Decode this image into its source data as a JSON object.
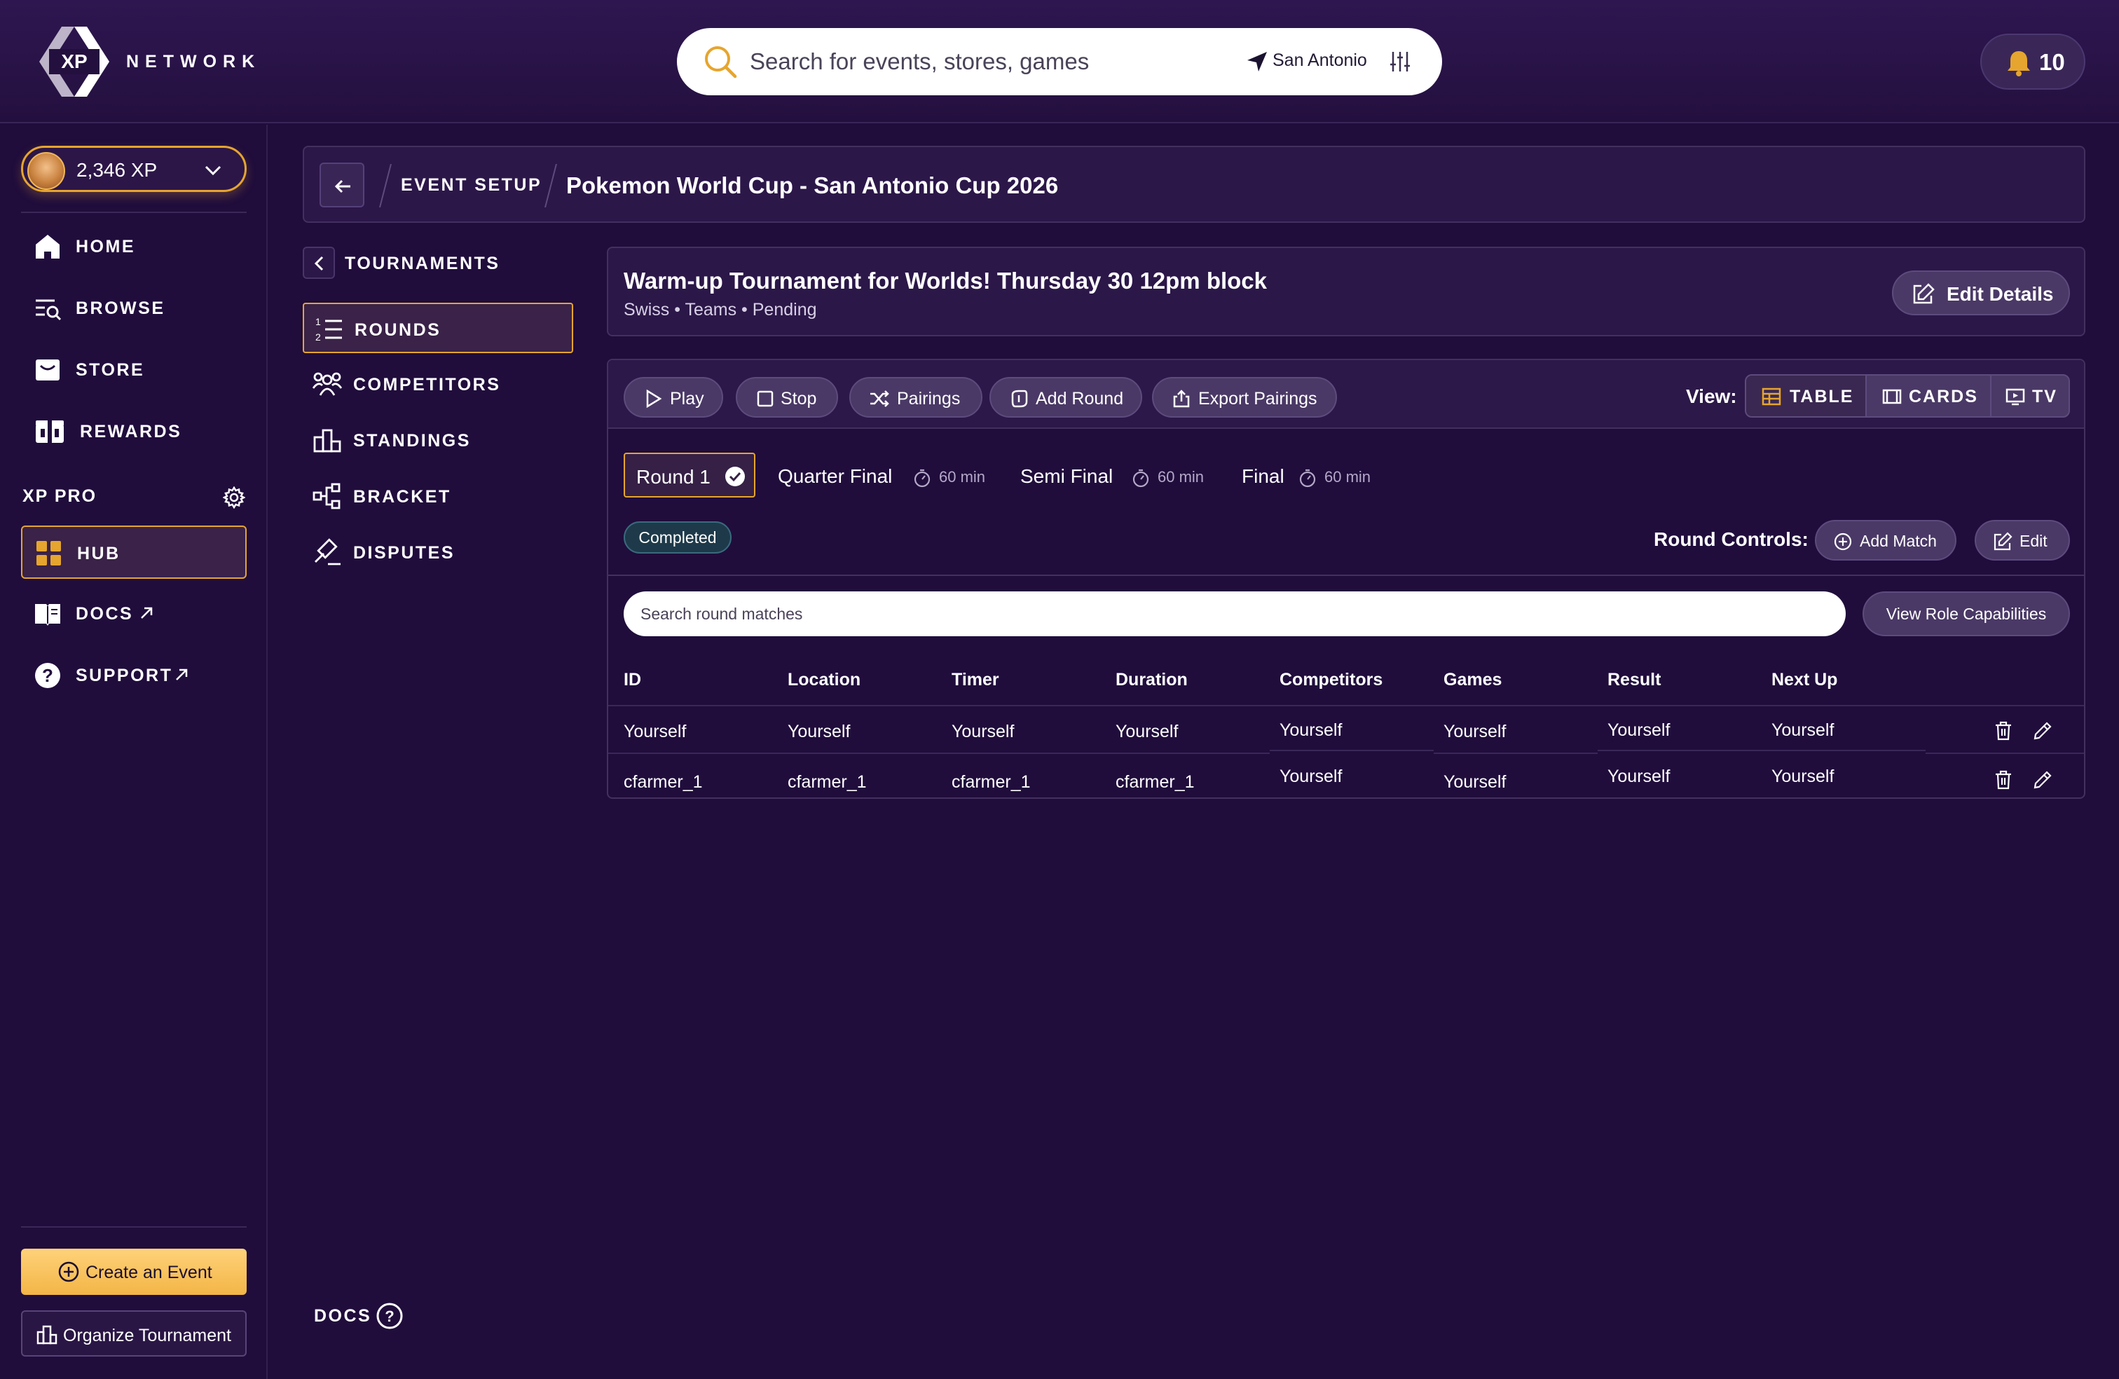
{
  "header": {
    "logo_badge": "XP",
    "logo_text": "NETWORK",
    "search_placeholder": "Search for events, stores, games",
    "location": "San Antonio",
    "notification_count": "10"
  },
  "sidebar": {
    "xp_balance": "2,346 XP",
    "nav": [
      {
        "label": "HOME",
        "icon": "home-icon"
      },
      {
        "label": "BROWSE",
        "icon": "browse-icon"
      },
      {
        "label": "STORE",
        "icon": "store-icon"
      },
      {
        "label": "REWARDS",
        "icon": "rewards-icon"
      }
    ],
    "section_label": "XP PRO",
    "pro_nav": [
      {
        "label": "HUB",
        "icon": "hub-grid-icon",
        "active": true
      },
      {
        "label": "DOCS",
        "icon": "docs-book-icon",
        "external": true
      },
      {
        "label": "SUPPORT",
        "icon": "help-icon",
        "external": true
      }
    ],
    "create_event_label": "Create an Event",
    "organize_label": "Organize Tournament"
  },
  "breadcrumb": {
    "section": "EVENT SETUP",
    "title": "Pokemon World Cup - San Antonio Cup 2026"
  },
  "subnav": {
    "back_label": "TOURNAMENTS",
    "items": [
      {
        "label": "ROUNDS",
        "icon": "rounds-list-icon",
        "active": true
      },
      {
        "label": "COMPETITORS",
        "icon": "competitors-icon"
      },
      {
        "label": "STANDINGS",
        "icon": "standings-icon"
      },
      {
        "label": "BRACKET",
        "icon": "bracket-icon"
      },
      {
        "label": "DISPUTES",
        "icon": "gavel-icon"
      }
    ],
    "docs_label": "DOCS"
  },
  "tournament": {
    "title": "Warm-up Tournament for Worlds! Thursday 30 12pm block",
    "meta": "Swiss • Teams • Pending",
    "edit_label": "Edit Details"
  },
  "toolbar": {
    "buttons": [
      "Play",
      "Stop",
      "Pairings",
      "Add Round",
      "Export Pairings"
    ],
    "view_label": "View:",
    "view_options": [
      "TABLE",
      "CARDS",
      "TV"
    ],
    "active_view": "TABLE"
  },
  "rounds": {
    "tabs": [
      {
        "label": "Round 1",
        "active": true,
        "completed": true
      },
      {
        "label": "Quarter Final",
        "time": "60 min"
      },
      {
        "label": "Semi Final",
        "time": "60 min"
      },
      {
        "label": "Final",
        "time": "60 min"
      }
    ],
    "status": "Completed",
    "controls_label": "Round Controls:",
    "add_match_label": "Add Match",
    "edit_label": "Edit",
    "search_placeholder": "Search round matches",
    "role_cap_label": "View Role Capabilities"
  },
  "table": {
    "columns": [
      "ID",
      "Location",
      "Timer",
      "Duration",
      "Competitors",
      "Games",
      "Result",
      "Next Up"
    ],
    "rows": [
      [
        "Yourself",
        "Yourself",
        "Yourself",
        "Yourself",
        "Yourself",
        "Yourself",
        "Yourself",
        "Yourself"
      ],
      [
        "cfarmer_1",
        "cfarmer_1",
        "cfarmer_1",
        "cfarmer_1",
        "Yourself",
        "Yourself",
        "Yourself",
        "Yourself"
      ]
    ]
  },
  "colors": {
    "background": "#200d3c",
    "accent": "#e6a52e",
    "panel": "#2c1749",
    "button": "#4a3966"
  }
}
